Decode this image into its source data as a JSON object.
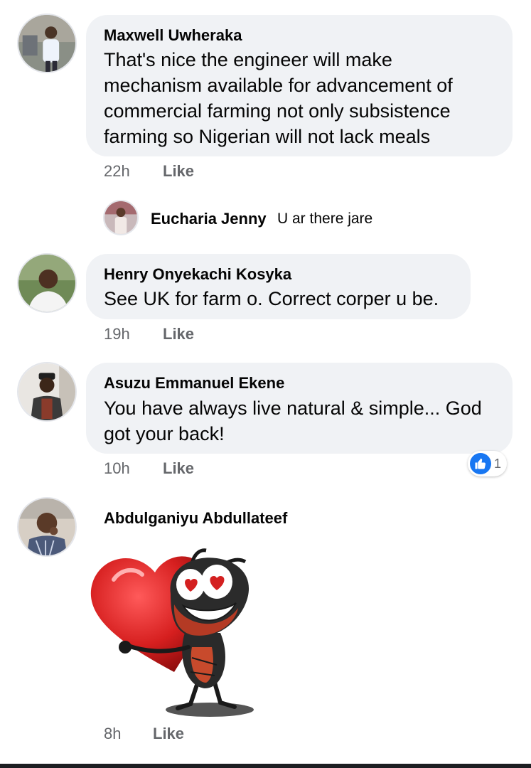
{
  "comments": [
    {
      "author": "Maxwell Uwheraka",
      "lines": [
        "That's nice the engineer will make",
        "mechanism available for advancement of",
        "commercial farming not only subsistence",
        "farming so Nigerian will not lack meals"
      ],
      "time": "22h",
      "like_label": "Like",
      "reply": {
        "author": "Eucharia Jenny",
        "text": "U ar there jare"
      }
    },
    {
      "author": "Henry Onyekachi Kosyka",
      "lines": [
        "See UK for farm o. Correct corper u be."
      ],
      "time": "19h",
      "like_label": "Like"
    },
    {
      "author": "Asuzu Emmanuel Ekene",
      "lines": [
        "You have always live natural & simple... God",
        "got your back!"
      ],
      "time": "10h",
      "like_label": "Like",
      "reaction": {
        "icon": "thumbs-up-icon",
        "count": "1",
        "color": "#1877f2"
      }
    },
    {
      "author": "Abdulganiyu Abdullateef",
      "sticker": "heart-hug-sticker",
      "time": "8h",
      "like_label": "Like"
    }
  ],
  "colors": {
    "bubble": "#f0f2f5",
    "meta": "#65676b",
    "accent": "#1877f2"
  }
}
